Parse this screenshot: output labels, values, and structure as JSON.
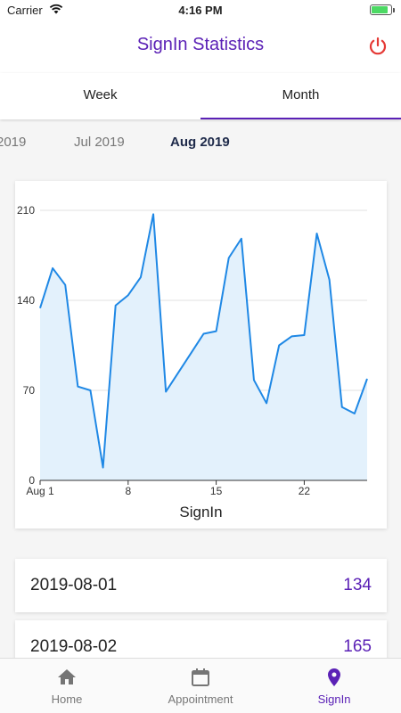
{
  "status_bar": {
    "carrier": "Carrier",
    "time": "4:16 PM",
    "battery_level": 0.85
  },
  "app_bar": {
    "title": "SignIn Statistics",
    "action_icon": "power-icon",
    "accent": "#5b21b6",
    "action_color": "#e53935"
  },
  "tabs": [
    {
      "label": "Week"
    },
    {
      "label": "Month",
      "selected": true
    }
  ],
  "months": [
    {
      "label": "2019"
    },
    {
      "label": "Jul 2019"
    },
    {
      "label": "Aug 2019",
      "selected": true
    }
  ],
  "chart_data": {
    "type": "area",
    "xlabel": "SignIn",
    "x": [
      1,
      2,
      3,
      4,
      5,
      6,
      7,
      8,
      9,
      10,
      11,
      12,
      13,
      14,
      15,
      16,
      17,
      18,
      19,
      20,
      21,
      22,
      23,
      24,
      25,
      26,
      27
    ],
    "values": [
      134,
      165,
      152,
      73,
      70,
      10,
      136,
      144,
      158,
      207,
      69,
      84,
      99,
      114,
      116,
      173,
      188,
      78,
      60,
      105,
      112,
      113,
      192,
      156,
      57,
      52,
      79
    ],
    "ylim": [
      0,
      210
    ],
    "y_ticks": [
      "0",
      "70",
      "140",
      "210"
    ],
    "x_ticks": [
      {
        "x": 1,
        "label": "Aug 1"
      },
      {
        "x": 8,
        "label": "8"
      },
      {
        "x": 15,
        "label": "15"
      },
      {
        "x": 22,
        "label": "22"
      }
    ],
    "line_color": "#1f88e5",
    "fill_color": "#e3f1fc",
    "grid": true
  },
  "records": [
    {
      "date": "2019-08-01",
      "count": "134"
    },
    {
      "date": "2019-08-02",
      "count": "165"
    }
  ],
  "bottom_nav": [
    {
      "label": "Home",
      "icon": "home-icon"
    },
    {
      "label": "Appointment",
      "icon": "calendar-icon"
    },
    {
      "label": "SignIn",
      "icon": "location-pin-icon",
      "selected": true
    }
  ]
}
